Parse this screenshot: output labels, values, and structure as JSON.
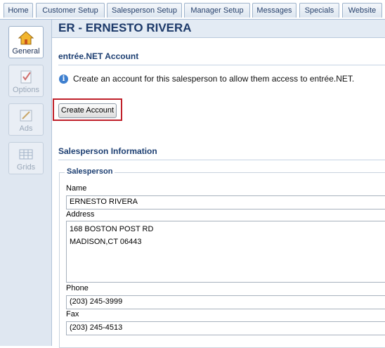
{
  "tabs": [
    "Home",
    "Customer Setup",
    "Salesperson Setup",
    "Manager Setup",
    "Messages",
    "Specials",
    "Website"
  ],
  "sidebar": {
    "items": [
      {
        "label": "General",
        "icon": "house-icon"
      },
      {
        "label": "Options",
        "icon": "checklist-icon"
      },
      {
        "label": "Ads",
        "icon": "ads-icon"
      },
      {
        "label": "Grids",
        "icon": "grid-icon"
      }
    ]
  },
  "header": {
    "title": "ER - ERNESTO RIVERA"
  },
  "account": {
    "title": "entrée.NET Account",
    "info": "Create an account for this salesperson to allow them access to entrée.NET.",
    "button_label": "Create Account"
  },
  "salesperson_info": {
    "title": "Salesperson Information",
    "legend": "Salesperson",
    "name_label": "Name",
    "name_value": "ERNESTO RIVERA",
    "address_label": "Address",
    "address_lines": [
      "168 BOSTON POST RD",
      "MADISON,CT 06443"
    ],
    "phone_label": "Phone",
    "phone_value": "(203) 245-3999",
    "fax_label": "Fax",
    "fax_value": "(203) 245-4513"
  },
  "colors": {
    "accent": "#1d3f72",
    "highlight": "#c0202a",
    "sidebar_bg": "#dfe7f1"
  }
}
